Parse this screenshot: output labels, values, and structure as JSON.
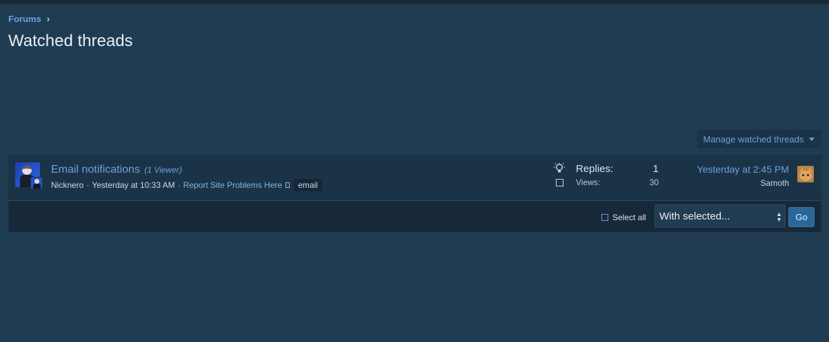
{
  "breadcrumb": {
    "forums_label": "Forums",
    "separator": "›"
  },
  "page": {
    "title": "Watched threads"
  },
  "manage": {
    "label": "Manage watched threads"
  },
  "thread": {
    "title": "Email notifications",
    "viewers": "(1 Viewer)",
    "author": "Nicknero",
    "date": "Yesterday at 10:33 AM",
    "forum": "Report Site Problems Here",
    "tag": "email",
    "replies_label": "Replies:",
    "replies": "1",
    "views_label": "Views:",
    "views": "30",
    "latest_time": "Yesterday at 2:45 PM",
    "latest_user": "Samoth",
    "icons": [
      "lightbulb-icon",
      "checkbox-icon"
    ]
  },
  "footer": {
    "select_all_label": "Select all",
    "with_selected": "With selected...",
    "go_label": "Go"
  },
  "colors": {
    "background": "#203c52",
    "accent": "#6ba1dd",
    "row": "#1b3347",
    "footer": "#172838",
    "button": "#2a6698"
  }
}
